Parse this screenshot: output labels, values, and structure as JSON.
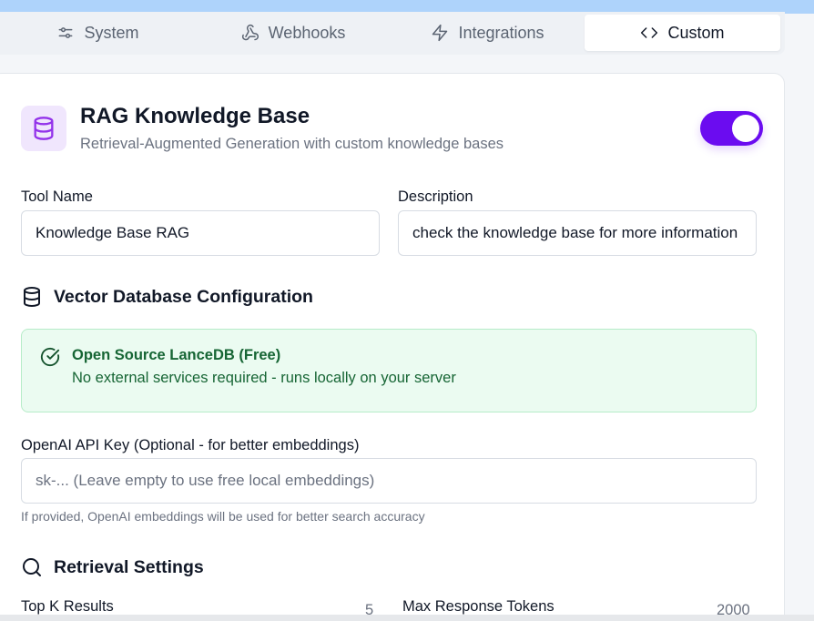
{
  "tabs": [
    {
      "label": "System",
      "icon": "sliders-icon"
    },
    {
      "label": "Webhooks",
      "icon": "webhook-icon"
    },
    {
      "label": "Integrations",
      "icon": "zap-icon"
    },
    {
      "label": "Custom",
      "icon": "code-icon",
      "active": true
    }
  ],
  "tool": {
    "title": "RAG Knowledge Base",
    "subtitle": "Retrieval-Augmented Generation with custom knowledge bases",
    "icon": "database-icon",
    "enabled": true,
    "accent": "#6b0cf0"
  },
  "fields": {
    "tool_name_label": "Tool Name",
    "tool_name_value": "Knowledge Base RAG",
    "description_label": "Description",
    "description_value": "check the knowledge base for more information"
  },
  "vector_db": {
    "heading": "Vector Database Configuration",
    "notice_title": "Open Source LanceDB (Free)",
    "notice_text": "No external services required - runs locally on your server",
    "api_key_label": "OpenAI API Key (Optional - for better embeddings)",
    "api_key_placeholder": "sk-... (Leave empty to use free local embeddings)",
    "api_key_hint": "If provided, OpenAI embeddings will be used for better search accuracy"
  },
  "retrieval": {
    "heading": "Retrieval Settings",
    "top_k_label": "Top K Results",
    "top_k_value": "5",
    "max_tokens_label": "Max Response Tokens",
    "max_tokens_value": "2000"
  }
}
